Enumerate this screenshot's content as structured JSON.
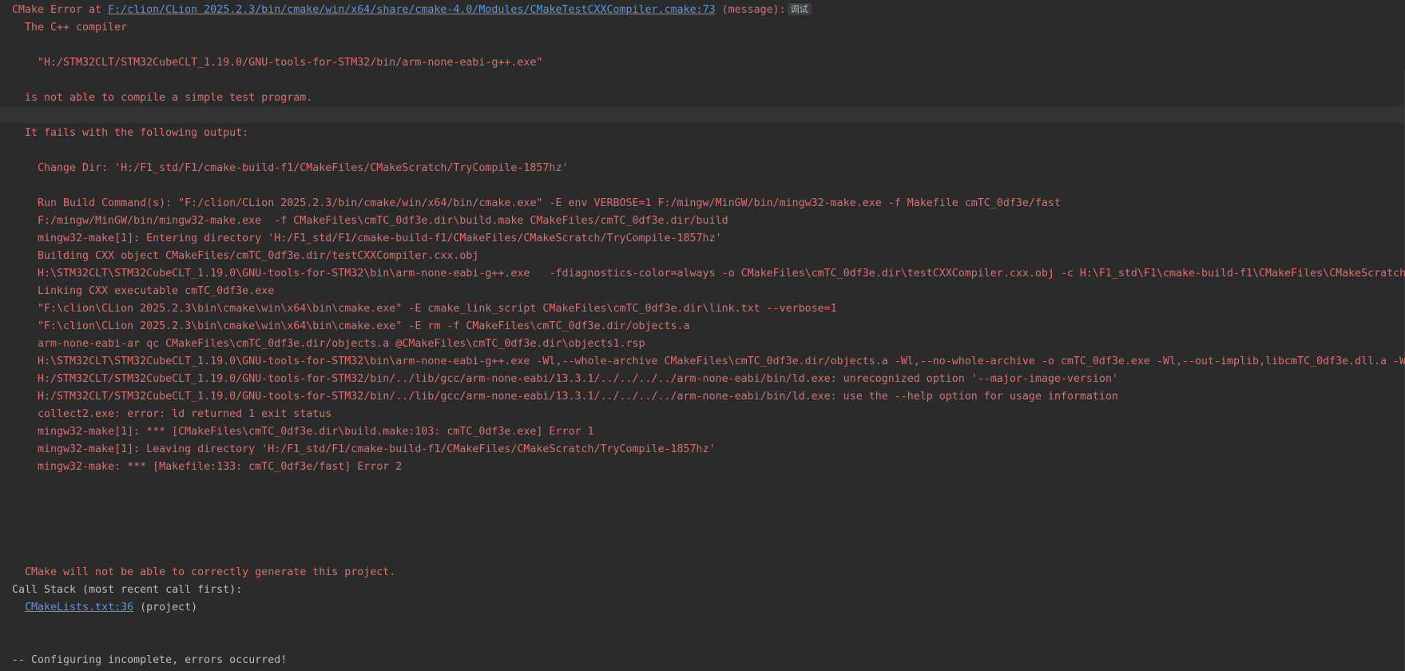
{
  "console": {
    "header": {
      "prefix": "CMake Error at ",
      "file_link": "F:/clion/CLion 2025.2.3/bin/cmake/win/x64/share/cmake-4.0/Modules/CMakeTestCXXCompiler.cmake:73",
      "suffix": " (message):",
      "debug_badge": "调试"
    },
    "intro": {
      "line1": "The C++ compiler",
      "line2": "\"H:/STM32CLT/STM32CubeCLT_1.19.0/GNU-tools-for-STM32/bin/arm-none-eabi-g++.exe\"",
      "line3": "is not able to compile a simple test program.",
      "line4": "It fails with the following output:"
    },
    "output_lines": [
      "Change Dir: 'H:/F1_std/F1/cmake-build-f1/CMakeFiles/CMakeScratch/TryCompile-1857hz'",
      "",
      "Run Build Command(s): \"F:/clion/CLion 2025.2.3/bin/cmake/win/x64/bin/cmake.exe\" -E env VERBOSE=1 F:/mingw/MinGW/bin/mingw32-make.exe -f Makefile cmTC_0df3e/fast",
      "F:/mingw/MinGW/bin/mingw32-make.exe  -f CMakeFiles\\cmTC_0df3e.dir\\build.make CMakeFiles/cmTC_0df3e.dir/build",
      "mingw32-make[1]: Entering directory 'H:/F1_std/F1/cmake-build-f1/CMakeFiles/CMakeScratch/TryCompile-1857hz'",
      "Building CXX object CMakeFiles/cmTC_0df3e.dir/testCXXCompiler.cxx.obj",
      "H:\\STM32CLT\\STM32CubeCLT_1.19.0\\GNU-tools-for-STM32\\bin\\arm-none-eabi-g++.exe   -fdiagnostics-color=always -o CMakeFiles\\cmTC_0df3e.dir\\testCXXCompiler.cxx.obj -c H:\\F1_std\\F1\\cmake-build-f1\\CMakeFiles\\CMakeScratch",
      "Linking CXX executable cmTC_0df3e.exe",
      "\"F:\\clion\\CLion 2025.2.3\\bin\\cmake\\win\\x64\\bin\\cmake.exe\" -E cmake_link_script CMakeFiles\\cmTC_0df3e.dir\\link.txt --verbose=1",
      "\"F:\\clion\\CLion 2025.2.3\\bin\\cmake\\win\\x64\\bin\\cmake.exe\" -E rm -f CMakeFiles\\cmTC_0df3e.dir/objects.a",
      "arm-none-eabi-ar qc CMakeFiles\\cmTC_0df3e.dir/objects.a @CMakeFiles\\cmTC_0df3e.dir\\objects1.rsp",
      "H:\\STM32CLT\\STM32CubeCLT_1.19.0\\GNU-tools-for-STM32\\bin\\arm-none-eabi-g++.exe -Wl,--whole-archive CMakeFiles\\cmTC_0df3e.dir/objects.a -Wl,--no-whole-archive -o cmTC_0df3e.exe -Wl,--out-implib,libcmTC_0df3e.dll.a -W",
      "H:/STM32CLT/STM32CubeCLT_1.19.0/GNU-tools-for-STM32/bin/../lib/gcc/arm-none-eabi/13.3.1/../../../../arm-none-eabi/bin/ld.exe: unrecognized option '--major-image-version'",
      "H:/STM32CLT/STM32CubeCLT_1.19.0/GNU-tools-for-STM32/bin/../lib/gcc/arm-none-eabi/13.3.1/../../../../arm-none-eabi/bin/ld.exe: use the --help option for usage information",
      "collect2.exe: error: ld returned 1 exit status",
      "mingw32-make[1]: *** [CMakeFiles\\cmTC_0df3e.dir\\build.make:103: cmTC_0df3e.exe] Error 1",
      "mingw32-make[1]: Leaving directory 'H:/F1_std/F1/cmake-build-f1/CMakeFiles/CMakeScratch/TryCompile-1857hz'",
      "mingw32-make: *** [Makefile:133: cmTC_0df3e/fast] Error 2"
    ],
    "outro": "CMake will not be able to correctly generate this project.",
    "call_stack": {
      "title": "Call Stack (most recent call first):",
      "link": "CMakeLists.txt:36",
      "suffix": " (project)"
    },
    "footer": "-- Configuring incomplete, errors occurred!"
  },
  "colors": {
    "background": "#2b2b2b",
    "error_text": "#e06c6c",
    "plain_text": "#bbbbbb",
    "link": "#5c93e3",
    "highlighted_row": "#313335"
  }
}
